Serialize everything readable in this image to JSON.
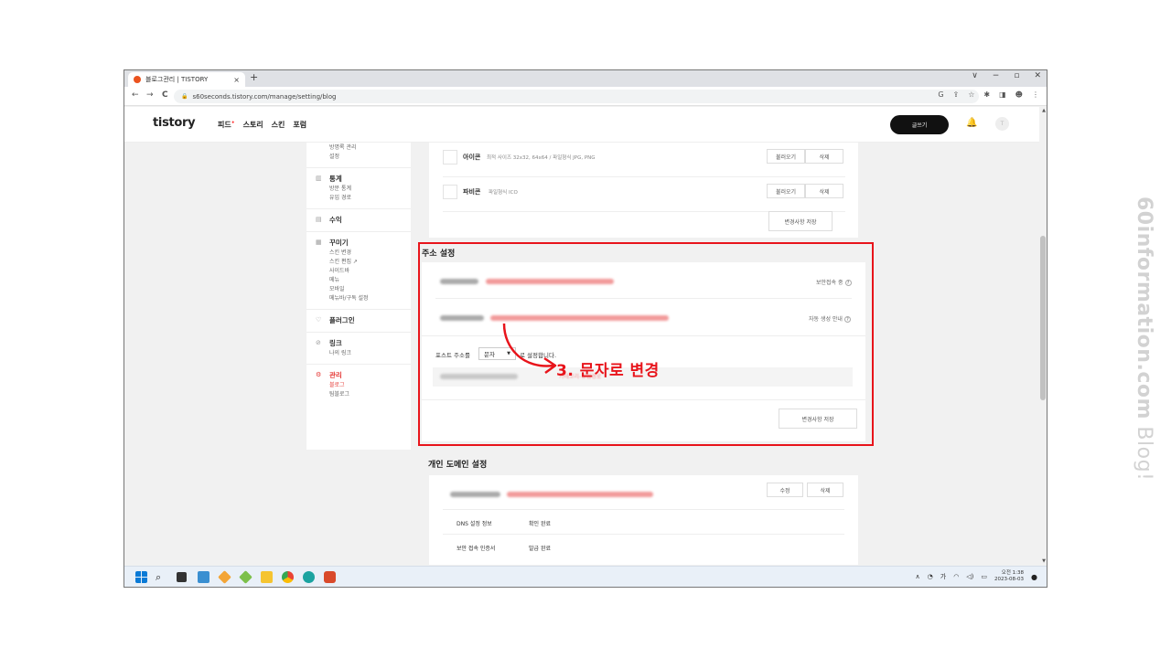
{
  "browser": {
    "tab_title": "블로그관리 | TISTORY",
    "tab_close": "×",
    "new_tab": "+",
    "window_controls": [
      "∨",
      "−",
      "▫",
      "✕"
    ],
    "url": "s60seconds.tistory.com/manage/setting/blog",
    "nav": {
      "back": "←",
      "forward": "→",
      "reload": "C"
    },
    "toolbar_icons": [
      "G",
      "⇪",
      "☆",
      "✱",
      "◨",
      "☻",
      "⋮"
    ]
  },
  "gnb": {
    "logo": "tistory",
    "menu": [
      "피드",
      "스토리",
      "스킨",
      "포럼"
    ],
    "feed_dot": "•",
    "write_button": "글쓰기",
    "bell": "🔔",
    "avatar": "T"
  },
  "sidebar": {
    "top_items": [
      "방명록 관리",
      "설정"
    ],
    "groups": [
      {
        "icon": "▥",
        "title": "통계",
        "items": [
          "방문 통계",
          "유입 경로"
        ]
      },
      {
        "icon": "▤",
        "title": "수익",
        "items": []
      },
      {
        "icon": "▦",
        "title": "꾸미기",
        "items": [
          "스킨 변경",
          "스킨 편집 ↗",
          "사이드바",
          "메뉴",
          "모바일",
          "메뉴바/구독 설정"
        ]
      },
      {
        "icon": "♡",
        "title": "플러그인",
        "items": []
      },
      {
        "icon": "⊘",
        "title": "링크",
        "items": [
          "나의 링크"
        ]
      },
      {
        "icon": "⚙",
        "title": "관리",
        "items": [
          "블로그",
          "팀블로그"
        ]
      }
    ]
  },
  "icons_panel": {
    "rows": [
      {
        "label": "아이콘",
        "desc": "최적 사이즈 32x32, 64x64 / 파일형식 JPG, PNG",
        "load": "불러오기",
        "delete": "삭제"
      },
      {
        "label": "파비콘",
        "desc": "파일형식 ICO",
        "load": "불러오기",
        "delete": "삭제"
      }
    ],
    "save": "변경사항 저장"
  },
  "address_settings": {
    "title": "주소 설정",
    "secure_label": "보안접속 중",
    "auto_label": "자동 생성 안내",
    "post_label": "포스트 주소를",
    "post_select": "문자",
    "post_suffix": "로 설정합니다.",
    "preview_tail": "카테고리-유입경로",
    "save": "변경사항 저장",
    "annotation": "3. 문자로 변경"
  },
  "domain_settings": {
    "title": "개인 도메인 설정",
    "edit": "수정",
    "delete": "삭제",
    "rows": [
      {
        "key": "DNS 설정 정보",
        "value": "확인 완료"
      },
      {
        "key": "보안 접속 인증서",
        "value": "발급 완료"
      }
    ]
  },
  "taskbar": {
    "tray": [
      "∧",
      "◔",
      "가",
      "◠",
      "◁)",
      "▭"
    ],
    "time": "오전 1:38",
    "date": "2023-08-03",
    "badge": "●"
  },
  "watermark": {
    "main": "60information.com",
    "suffix": " Blog!"
  },
  "colors": {
    "accent_red": "#e8141b",
    "tistory_red": "#eb531f",
    "menu_active": "#e53935"
  }
}
